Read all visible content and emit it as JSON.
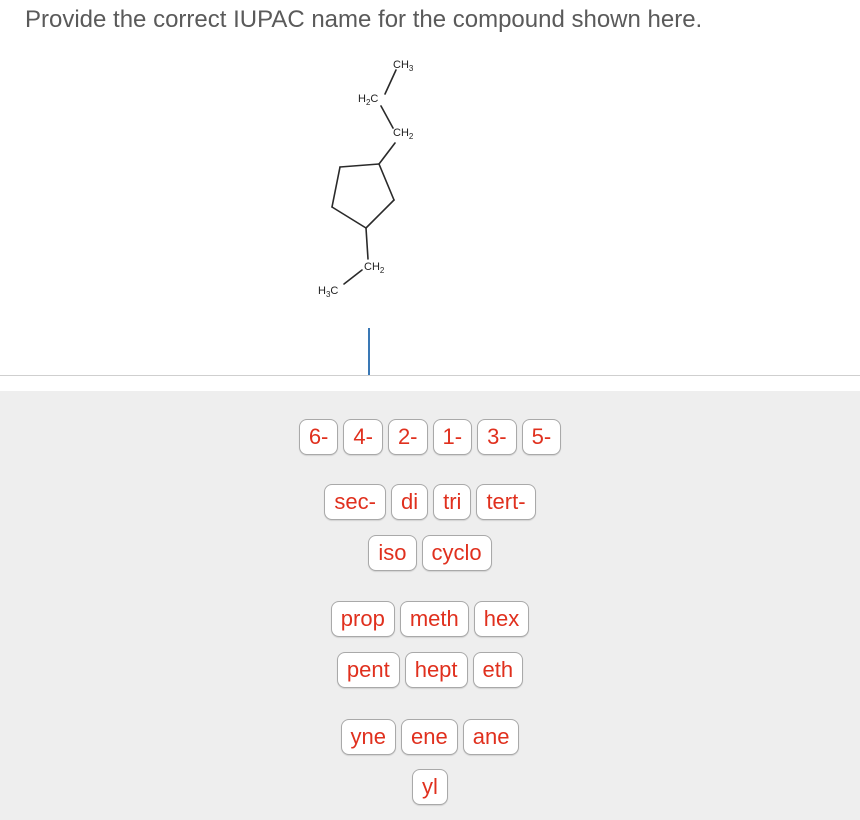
{
  "question": {
    "prompt": "Provide the correct IUPAC name for the compound shown here."
  },
  "molecule": {
    "description": "cyclopentane ring with propyl and ethyl substituents",
    "labels": {
      "propyl_ch3": "CH3",
      "propyl_h2c": "H2C",
      "propyl_ch2": "CH2",
      "ethyl_ch2": "CH2",
      "ethyl_h3c": "H3C"
    }
  },
  "answer_field": {
    "value": ""
  },
  "tiles": {
    "locants": [
      "6-",
      "4-",
      "2-",
      "1-",
      "3-",
      "5-"
    ],
    "prefixes_row1": [
      "sec-",
      "di",
      "tri",
      "tert-"
    ],
    "prefixes_row2": [
      "iso",
      "cyclo"
    ],
    "roots_row1": [
      "prop",
      "meth",
      "hex"
    ],
    "roots_row2": [
      "pent",
      "hept",
      "eth"
    ],
    "suffixes": [
      "yne",
      "ene",
      "ane"
    ],
    "substituent_suffix": [
      "yl"
    ]
  },
  "colors": {
    "tile_text": "#e0301e",
    "tray_background": "#eeeeee",
    "cursor": "#3a78b5"
  }
}
